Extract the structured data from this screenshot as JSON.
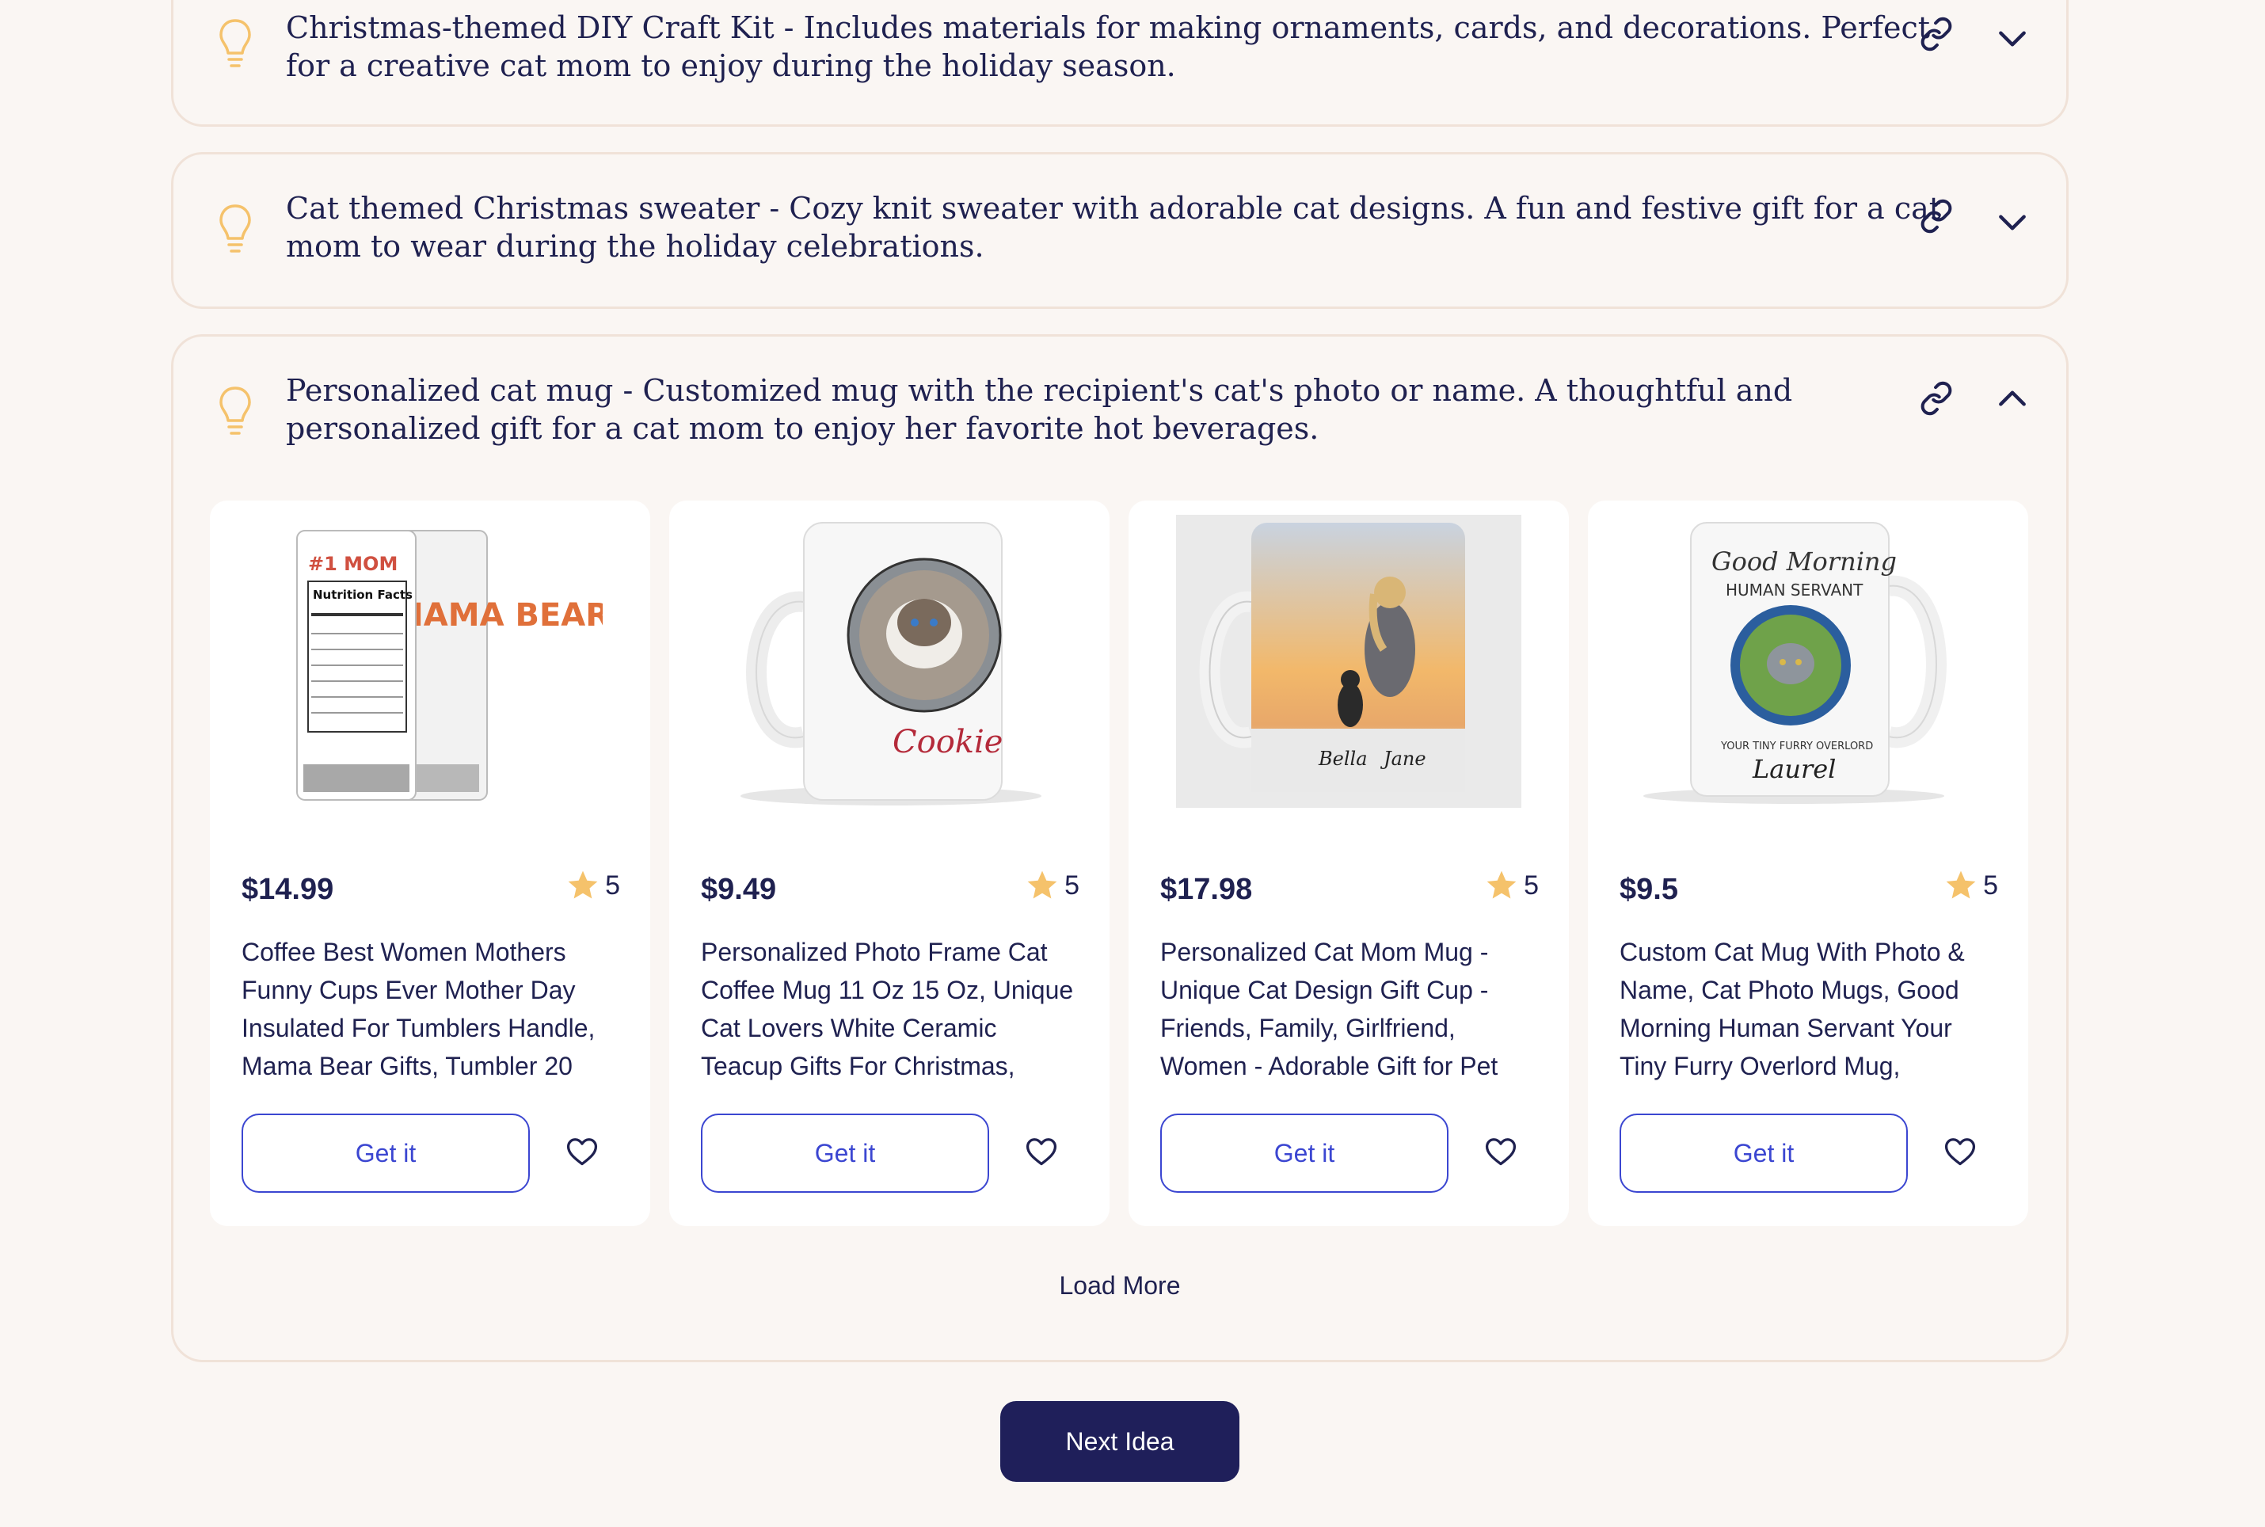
{
  "ideas": [
    {
      "text": "Christmas-themed DIY Craft Kit - Includes materials for making ornaments, cards, and decorations. Perfect for a creative cat mom to enjoy during the holiday season.",
      "expanded": false
    },
    {
      "text": "Cat themed Christmas sweater - Cozy knit sweater with adorable cat designs. A fun and festive gift for a cat mom to wear during the holiday celebrations.",
      "expanded": false
    },
    {
      "text": "Personalized cat mug - Customized mug with the recipient's cat's photo or name. A thoughtful and personalized gift for a cat mom to enjoy her favorite hot beverages.",
      "expanded": true
    }
  ],
  "products": [
    {
      "price": "$14.99",
      "rating": "5",
      "title": "Coffee Best Women Mothers Funny Cups Ever Mother Day Insulated For Tumblers Handle, Mama Bear Gifts, Tumbler 20",
      "button": "Get it",
      "image_icon": "tumbler-image",
      "image_texts": [
        "#1 MOM",
        "Nutrition Facts",
        "MAMA BEAR"
      ]
    },
    {
      "price": "$9.49",
      "rating": "5",
      "title": "Personalized Photo Frame Cat Coffee Mug 11 Oz 15 Oz, Unique Cat Lovers White Ceramic Teacup Gifts For Christmas,",
      "button": "Get it",
      "image_icon": "cat-photo-mug-image",
      "image_texts": [
        "Cookie"
      ]
    },
    {
      "price": "$17.98",
      "rating": "5",
      "title": "Personalized Cat Mom Mug - Unique Cat Design Gift Cup - Friends, Family, Girlfriend, Women - Adorable Gift for Pet",
      "button": "Get it",
      "image_icon": "sunset-cat-mug-image",
      "image_texts": [
        "Bella",
        "Jane"
      ]
    },
    {
      "price": "$9.5",
      "rating": "5",
      "title": "Custom Cat Mug With Photo & Name, Cat Photo Mugs, Good Morning Human Servant Your Tiny Furry Overlord Mug,",
      "button": "Get it",
      "image_icon": "human-servant-mug-image",
      "image_texts": [
        "Good Morning",
        "HUMAN SERVANT",
        "YOUR TINY FURRY OVERLORD",
        "Laurel"
      ]
    }
  ],
  "load_more": "Load More",
  "next_idea": "Next Idea",
  "colors": {
    "background": "#faf6f3",
    "card_border": "#f0e2d8",
    "text": "#1f2150",
    "accent_blue": "#3b46d1",
    "star": "#f5c26b",
    "bulb": "#f5c26b",
    "primary_button": "#1f1f5a"
  }
}
